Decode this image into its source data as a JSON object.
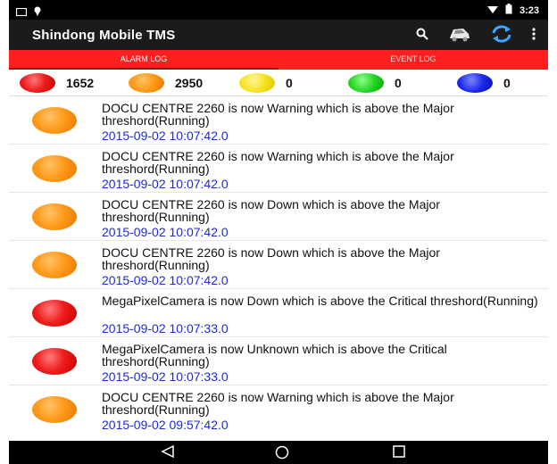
{
  "status_bar": {
    "time": "3:23"
  },
  "app": {
    "title": "Shindong Mobile TMS"
  },
  "tabs": [
    {
      "label": "ALARM LOG",
      "active": true
    },
    {
      "label": "EVENT LOG",
      "active": false
    }
  ],
  "counts": [
    {
      "color": "red",
      "value": "1652"
    },
    {
      "color": "orange",
      "value": "2950"
    },
    {
      "color": "yellow",
      "value": "0"
    },
    {
      "color": "green",
      "value": "0"
    },
    {
      "color": "blue",
      "value": "0"
    }
  ],
  "alarms": [
    {
      "severity": "orange",
      "message": "DOCU CENTRE 2260 is now Warning which is above the Major threshord(Running)",
      "timestamp": "2015-09-02 10:07:42.0"
    },
    {
      "severity": "orange",
      "message": "DOCU CENTRE 2260 is now Warning which is above the Major threshord(Running)",
      "timestamp": "2015-09-02 10:07:42.0"
    },
    {
      "severity": "orange",
      "message": "DOCU CENTRE 2260 is now Down which is above the Major threshord(Running)",
      "timestamp": "2015-09-02 10:07:42.0"
    },
    {
      "severity": "orange",
      "message": "DOCU CENTRE 2260 is now Down which is above the Major threshord(Running)",
      "timestamp": "2015-09-02 10:07:42.0"
    },
    {
      "severity": "red",
      "message": "MegaPixelCamera is now Down which is above the Critical threshord(Running)",
      "timestamp": "2015-09-02 10:07:33.0"
    },
    {
      "severity": "red",
      "message": "MegaPixelCamera is now Unknown which is above the Critical threshord(Running)",
      "timestamp": "2015-09-02 10:07:33.0"
    },
    {
      "severity": "orange",
      "message": "DOCU CENTRE 2260 is now Warning which is above the Major threshord(Running)",
      "timestamp": "2015-09-02 09:57:42.0"
    }
  ],
  "icons": {
    "search": "search-icon",
    "car": "car-icon",
    "refresh": "refresh-icon",
    "overflow": "overflow-menu-icon",
    "back": "back-icon",
    "home": "home-icon",
    "recents": "recents-icon"
  }
}
